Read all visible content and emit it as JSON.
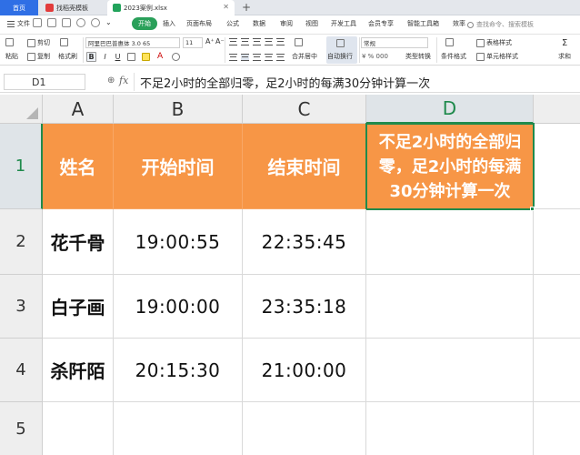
{
  "tabs": {
    "home": "首页",
    "doc1": "找稻壳模板",
    "doc2": "2023案例.xlsx",
    "add": "+"
  },
  "menu": {
    "file": "文件",
    "start": "开始",
    "items": [
      "插入",
      "页面布局",
      "公式",
      "数据",
      "审阅",
      "视图",
      "开发工具",
      "会员专享",
      "智能工具箱",
      "效率"
    ],
    "search_placeholder": "查找命令、搜索模板"
  },
  "ribbon": {
    "paste": "粘贴",
    "cut": "剪切",
    "copy": "复制",
    "format_painter": "格式刷",
    "font": "阿里巴巴普惠体 3.0 65",
    "font_size": "11",
    "merge_center": "合并居中",
    "auto_wrap": "自动换行",
    "number_format": "常规",
    "type_convert": "类型转换",
    "cond_format": "条件格式",
    "table_style": "表格样式",
    "cell_style": "单元格样式",
    "sum": "求和",
    "bold": "B",
    "italic": "I",
    "underline": "U"
  },
  "formula_bar": {
    "name_box": "D1",
    "fx": "fx",
    "content": "不足2小时的全部归零，足2小时的每满30分钟计算一次"
  },
  "grid": {
    "columns": [
      "A",
      "B",
      "C",
      "D"
    ],
    "rows": [
      "1",
      "2",
      "3",
      "4",
      "5"
    ],
    "header": [
      "姓名",
      "开始时间",
      "结束时间",
      "不足2小时的全部归零，足2小时的每满30分钟计算一次"
    ],
    "data": [
      [
        "花千骨",
        "19:00:55",
        "22:35:45",
        ""
      ],
      [
        "白子画",
        "19:00:00",
        "23:35:18",
        ""
      ],
      [
        "杀阡陌",
        "20:15:30",
        "21:00:00",
        ""
      ]
    ]
  },
  "colors": {
    "accent_green": "#1f8a4c",
    "header_fill": "#f79646",
    "tab_blue": "#2f6fe5"
  }
}
